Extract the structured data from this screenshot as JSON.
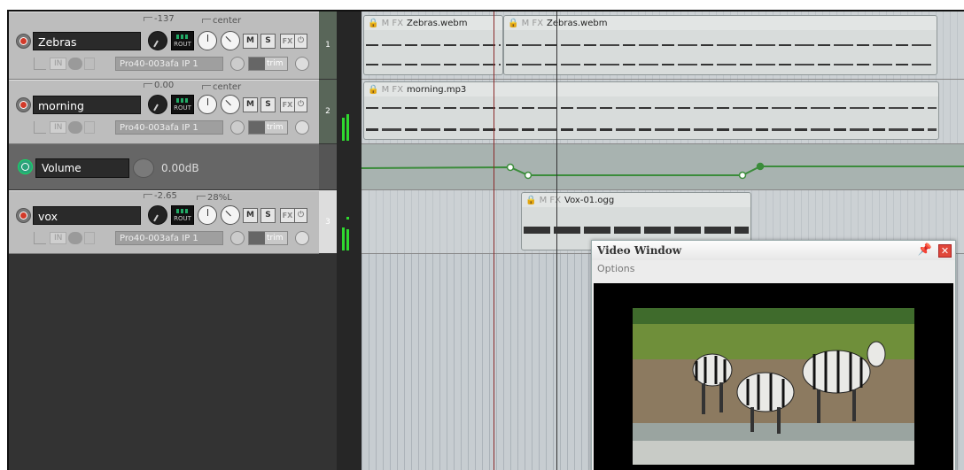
{
  "tracks": [
    {
      "number": "1",
      "name": "Zebras",
      "volume_label": "-137",
      "pan_label": "center",
      "fx_name": "Pro40-003afa IP 1",
      "io_in": "IN",
      "trim": "trim",
      "rout": "ROUT"
    },
    {
      "number": "2",
      "name": "morning",
      "volume_label": "0.00",
      "pan_label": "center",
      "fx_name": "Pro40-003afa IP 1",
      "io_in": "IN",
      "trim": "trim",
      "rout": "ROUT"
    },
    {
      "number": "3",
      "name": "vox",
      "volume_label": "-2.65",
      "pan_label": "28%L",
      "fx_name": "Pro40-003afa IP 1",
      "io_in": "IN",
      "trim": "trim",
      "rout": "ROUT"
    }
  ],
  "buttons": {
    "mute": "M",
    "solo": "S",
    "fx": "FX",
    "power": "⏻"
  },
  "envelope": {
    "name": "Volume",
    "value": "0.00dB"
  },
  "items": [
    {
      "label": "Zebras.webm",
      "icons": "🔒 M FX"
    },
    {
      "label": "Zebras.webm",
      "icons": "🔒 M FX"
    },
    {
      "label": "morning.mp3",
      "icons": "🔒 M FX"
    },
    {
      "label": "Vox-01.ogg",
      "icons": "🔒 M FX"
    }
  ],
  "video_window": {
    "title": "Video Window",
    "menu": "Options",
    "pin_icon": "📌",
    "close_icon": "✕"
  },
  "colors": {
    "envelope": "#3b8c3b",
    "meter": "#2fd82f",
    "record": "#d23a2a",
    "cursor": "#8a2a2a"
  }
}
